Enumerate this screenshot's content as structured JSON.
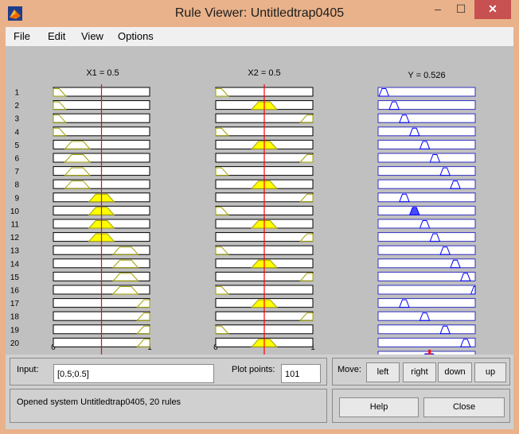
{
  "window": {
    "title": "Rule Viewer: Untitledtrap0405"
  },
  "titlebar_buttons": {
    "minimize": "–",
    "maximize": "☐",
    "close": "✕"
  },
  "menu": [
    "File",
    "Edit",
    "View",
    "Options"
  ],
  "columns": [
    {
      "header": "X1 = 0.5",
      "tick_left": "0",
      "tick_right": "1",
      "value": 0.5
    },
    {
      "header": "X2 = 0.5",
      "tick_left": "0",
      "tick_right": "1",
      "value": 0.5
    },
    {
      "header": "Y = 0.526",
      "value": 0.526
    }
  ],
  "rule_labels": [
    "1",
    "2",
    "3",
    "4",
    "5",
    "6",
    "7",
    "8",
    "9",
    "10",
    "11",
    "12",
    "13",
    "14",
    "15",
    "16",
    "17",
    "18",
    "19",
    "20"
  ],
  "rules": {
    "x1": [
      0,
      0,
      0,
      0,
      1,
      1,
      1,
      1,
      2,
      2,
      2,
      2,
      3,
      3,
      3,
      3,
      4,
      4,
      4,
      4
    ],
    "x2": [
      0,
      2,
      4,
      0,
      2,
      4,
      0,
      2,
      4,
      0,
      2,
      4,
      0,
      2,
      4,
      0,
      2,
      4,
      0,
      2
    ],
    "y": [
      0,
      1,
      2,
      3,
      4,
      5,
      6,
      7,
      2,
      3,
      4,
      5,
      6,
      7,
      8,
      9,
      2,
      4,
      6,
      8
    ],
    "x1_active": [
      false,
      false,
      false,
      false,
      false,
      false,
      false,
      false,
      true,
      true,
      true,
      true,
      false,
      false,
      false,
      false,
      false,
      false,
      false,
      false
    ],
    "x2_active": [
      false,
      true,
      false,
      false,
      true,
      false,
      false,
      true,
      false,
      false,
      true,
      false,
      false,
      true,
      false,
      false,
      true,
      false,
      false,
      true
    ],
    "y_active": [
      false,
      false,
      false,
      false,
      false,
      false,
      false,
      false,
      false,
      true,
      false,
      false,
      false,
      false,
      false,
      false,
      false,
      false,
      false,
      false
    ]
  },
  "controls": {
    "input_label": "Input:",
    "input_value": "[0.5;0.5]",
    "plot_points_label": "Plot points:",
    "plot_points_value": "101",
    "move_label": "Move:",
    "move_buttons": [
      "left",
      "right",
      "down",
      "up"
    ],
    "status": "Opened system Untitledtrap0405, 20 rules",
    "help": "Help",
    "close": "Close"
  },
  "colors": {
    "input_fill": "#ffff00",
    "input_line": "#a0a000",
    "output_fill": "#4a4aff",
    "output_line": "#0000ff",
    "indicator": "#ff0000"
  }
}
